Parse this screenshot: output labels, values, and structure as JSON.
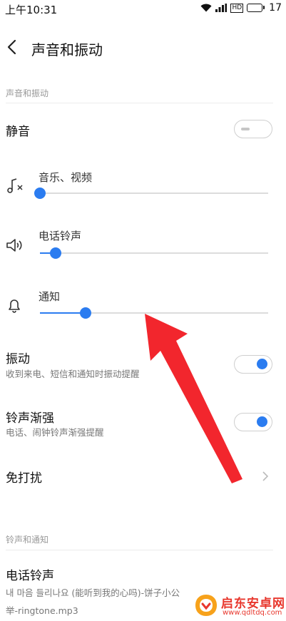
{
  "status_bar": {
    "time": "上午10:31",
    "hd_badge": "HD",
    "battery": "17"
  },
  "header": {
    "title": "声音和振动"
  },
  "section_sound": {
    "label": "声音和振动"
  },
  "mute": {
    "label": "静音",
    "on": false
  },
  "sliders": [
    {
      "label": "音乐、视频",
      "icon": "music-muted-icon",
      "value_fraction": 0.0
    },
    {
      "label": "电话铃声",
      "icon": "speaker-icon",
      "value_fraction": 0.07
    },
    {
      "label": "通知",
      "icon": "bell-icon",
      "value_fraction": 0.2
    }
  ],
  "vibrate": {
    "label": "振动",
    "subtitle": "收到来电、短信和通知时振动提醒",
    "on": true
  },
  "crescendo": {
    "label": "铃声渐强",
    "subtitle": "电话、闹钟铃声渐强提醒",
    "on": true
  },
  "dnd": {
    "label": "免打扰"
  },
  "section_ringtone": {
    "label": "铃声和通知"
  },
  "ringtone": {
    "label": "电话铃声",
    "value_line1": "내 마음 들리나요 (能听到我的心吗)-饼子小公",
    "value_line2": "举-ringtone.mp3"
  },
  "watermark": {
    "name": "启东安卓网",
    "url": "www.qdltdq.com"
  },
  "colors": {
    "accent": "#2b7cf0",
    "annotation_arrow": "#f2262d",
    "watermark": "#e8372d"
  }
}
